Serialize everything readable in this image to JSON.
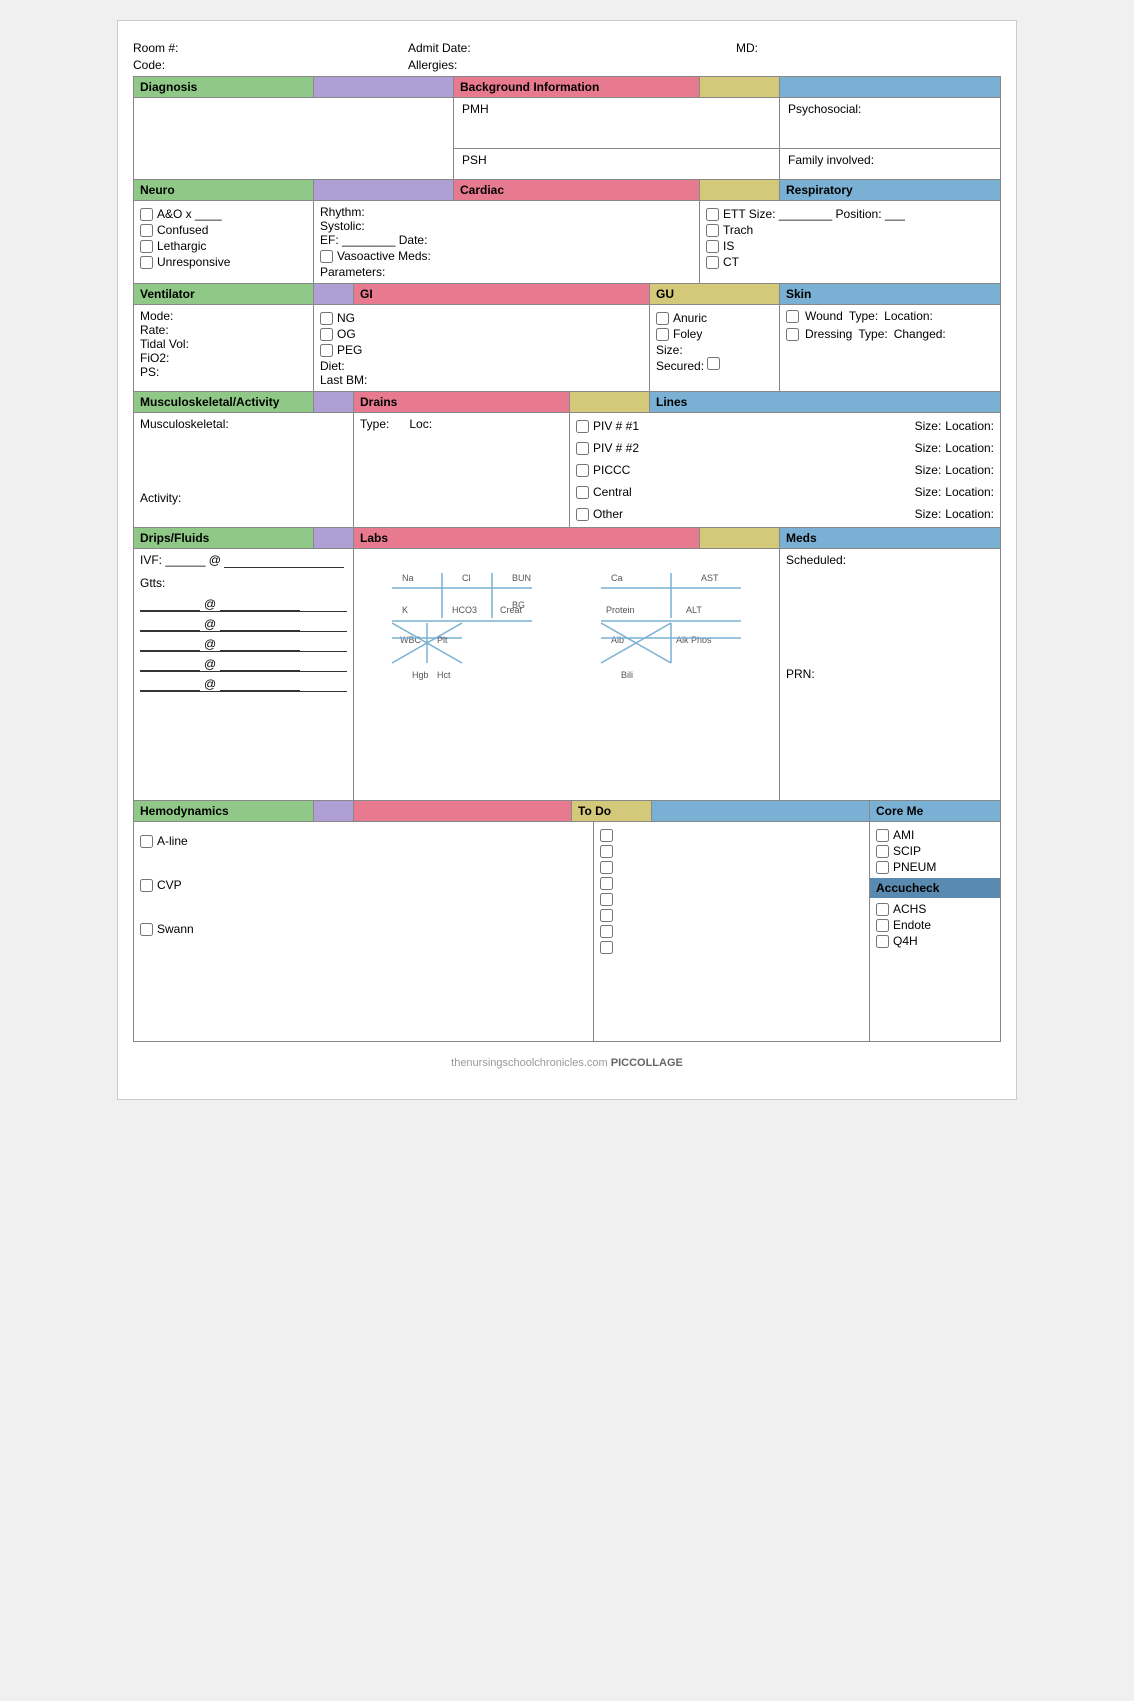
{
  "header": {
    "room_label": "Room #:",
    "code_label": "Code:",
    "admit_label": "Admit Date:",
    "allergies_label": "Allergies:",
    "md_label": "MD:"
  },
  "sections": {
    "diagnosis": "Diagnosis",
    "background": "Background Information",
    "neuro": "Neuro",
    "cardiac": "Cardiac",
    "respiratory": "Respiratory",
    "ventilator": "Ventilator",
    "gi": "GI",
    "gu": "GU",
    "skin": "Skin",
    "msk": "Musculoskeletal/Activity",
    "drains": "Drains",
    "lines": "Lines",
    "drips": "Drips/Fluids",
    "labs": "Labs",
    "meds": "Meds",
    "hemodynamics": "Hemodynamics",
    "todo": "To Do",
    "coreme": "Core Me"
  },
  "neuro": {
    "aox": "A&O x ____",
    "confused": "Confused",
    "lethargic": "Lethargic",
    "unresponsive": "Unresponsive"
  },
  "cardiac": {
    "rhythm": "Rhythm:",
    "systolic": "Systolic:",
    "ef": "EF: ________  Date:",
    "vasoactive": "Vasoactive Meds:",
    "parameters": "Parameters:"
  },
  "respiratory": {
    "ett": "ETT   Size: ________ Position: ___",
    "trach": "Trach",
    "is": "IS",
    "ct": "CT"
  },
  "ventilator": {
    "mode": "Mode:",
    "rate": "Rate:",
    "tidalvol": "Tidal Vol:",
    "fio2": "FiO2:",
    "ps": "PS:"
  },
  "gi": {
    "ng": "NG",
    "og": "OG",
    "peg": "PEG",
    "diet": "Diet:",
    "lastbm": "Last BM:"
  },
  "gu": {
    "anuric": "Anuric",
    "foley": "Foley",
    "size": "Size:",
    "secured": "Secured:"
  },
  "skin": {
    "wound": "Wound",
    "type": "Type:",
    "location": "Location:",
    "dressing": "Dressing",
    "dtype": "Type:",
    "changed": "Changed:"
  },
  "msk": {
    "musculoskeletal": "Musculoskeletal:",
    "activity": "Activity:"
  },
  "drains": {
    "type": "Type:",
    "loc": "Loc:"
  },
  "lines": {
    "piv1": "PIV # #1",
    "piv2": "PIV # #2",
    "piccc": "PICCC",
    "central": "Central",
    "other": "Other",
    "size": "Size:",
    "location": "Location:"
  },
  "drips": {
    "ivf": "IVF: ______ @",
    "gtts": "Gtts:"
  },
  "meds": {
    "scheduled": "Scheduled:",
    "prn": "PRN:"
  },
  "hemodynamics": {
    "aline": "A-line",
    "cvp": "CVP",
    "swann": "Swann"
  },
  "background": {
    "pmh": "PMH",
    "psh": "PSH",
    "psychosocial": "Psychosocial:",
    "family": "Family involved:"
  },
  "coreme": {
    "ami": "AMI",
    "scip": "SCIP",
    "pneum": "PNEUM",
    "accucheck": "Accucheck",
    "achs": "ACHS",
    "endote": "Endote",
    "q4h": "Q4H"
  },
  "footer": {
    "watermark": "thenursingschoolchronicles.com",
    "brand": "PICCOLLAGE"
  }
}
